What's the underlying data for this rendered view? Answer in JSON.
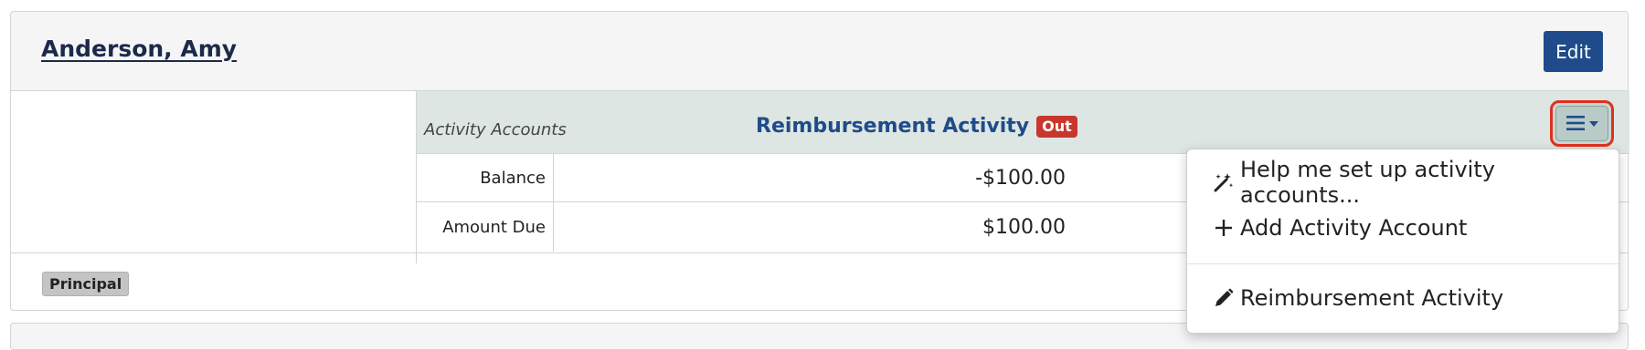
{
  "person": {
    "name": "Anderson, Amy",
    "edit_label": "Edit",
    "role_badge": "Principal"
  },
  "accounts": {
    "caption": "Activity Accounts",
    "column_title": "Reimbursement Activity",
    "status_badge": "Out",
    "rows": [
      {
        "label": "Balance",
        "value": "-$100.00"
      },
      {
        "label": "Amount Due",
        "value": "$100.00"
      }
    ]
  },
  "menu": {
    "button_icon": "hamburger-icon",
    "items": [
      {
        "label": "Help me set up activity accounts...",
        "icon": "magic-wand-icon"
      },
      {
        "label": "Add Activity Account",
        "icon": "plus-icon"
      },
      {
        "label": "Reimbursement Activity",
        "icon": "pencil-icon"
      }
    ]
  },
  "colors": {
    "primary": "#1f4b8a",
    "danger": "#c8372d",
    "header_bg": "#dde6e2",
    "highlight_ring": "#e0301e"
  }
}
